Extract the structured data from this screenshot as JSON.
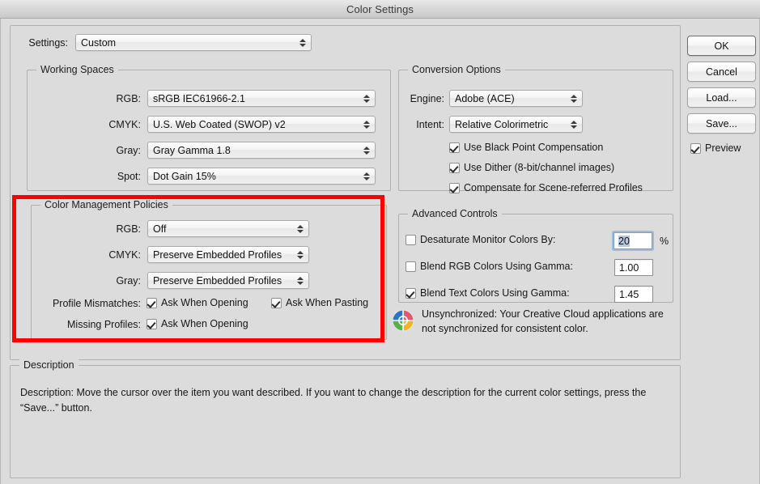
{
  "window": {
    "title": "Color Settings"
  },
  "settings_row": {
    "label": "Settings:",
    "value": "Custom"
  },
  "working_spaces": {
    "legend": "Working Spaces",
    "rows": [
      {
        "label": "RGB:",
        "value": "sRGB IEC61966-2.1"
      },
      {
        "label": "CMYK:",
        "value": "U.S. Web Coated (SWOP) v2"
      },
      {
        "label": "Gray:",
        "value": "Gray Gamma 1.8"
      },
      {
        "label": "Spot:",
        "value": "Dot Gain 15%"
      }
    ]
  },
  "color_management_policies": {
    "legend": "Color Management Policies",
    "rows": [
      {
        "label": "RGB:",
        "value": "Off"
      },
      {
        "label": "CMYK:",
        "value": "Preserve Embedded Profiles"
      },
      {
        "label": "Gray:",
        "value": "Preserve Embedded Profiles"
      }
    ],
    "profile_mismatches": {
      "label": "Profile Mismatches:",
      "ask_when_opening": "Ask When Opening",
      "ask_when_opening_checked": true,
      "ask_when_pasting": "Ask When Pasting",
      "ask_when_pasting_checked": true
    },
    "missing_profiles": {
      "label": "Missing Profiles:",
      "ask_when_opening": "Ask When Opening",
      "ask_when_opening_checked": true
    },
    "highlight_color": "#fe0000"
  },
  "conversion_options": {
    "legend": "Conversion Options",
    "engine": {
      "label": "Engine:",
      "value": "Adobe (ACE)"
    },
    "intent": {
      "label": "Intent:",
      "value": "Relative Colorimetric"
    },
    "checkboxes": [
      {
        "label": "Use Black Point Compensation",
        "checked": true
      },
      {
        "label": "Use Dither (8-bit/channel images)",
        "checked": true
      },
      {
        "label": "Compensate for Scene-referred Profiles",
        "checked": true
      }
    ]
  },
  "advanced_controls": {
    "legend": "Advanced Controls",
    "rows": [
      {
        "label": "Desaturate Monitor Colors By:",
        "checked": false,
        "value": "20",
        "unit": "%"
      },
      {
        "label": "Blend RGB Colors Using Gamma:",
        "checked": false,
        "value": "1.00",
        "unit": ""
      },
      {
        "label": "Blend Text Colors Using Gamma:",
        "checked": true,
        "value": "1.45",
        "unit": ""
      }
    ]
  },
  "sync_status": {
    "icon": "creative-cloud-color-wheel-icon",
    "text": "Unsynchronized: Your Creative Cloud applications are not synchronized for consistent color.",
    "colors": {
      "blue": "#2f74c0",
      "red": "#e05a6e",
      "green": "#59b14c",
      "yellow": "#f0b323"
    }
  },
  "description": {
    "legend": "Description",
    "text": "Description:  Move the cursor over the item you want described.  If you want to change the description for the current color settings, press the “Save...” button."
  },
  "buttons": {
    "ok": "OK",
    "cancel": "Cancel",
    "load": "Load...",
    "save": "Save...",
    "preview": {
      "label": "Preview",
      "checked": true
    }
  }
}
